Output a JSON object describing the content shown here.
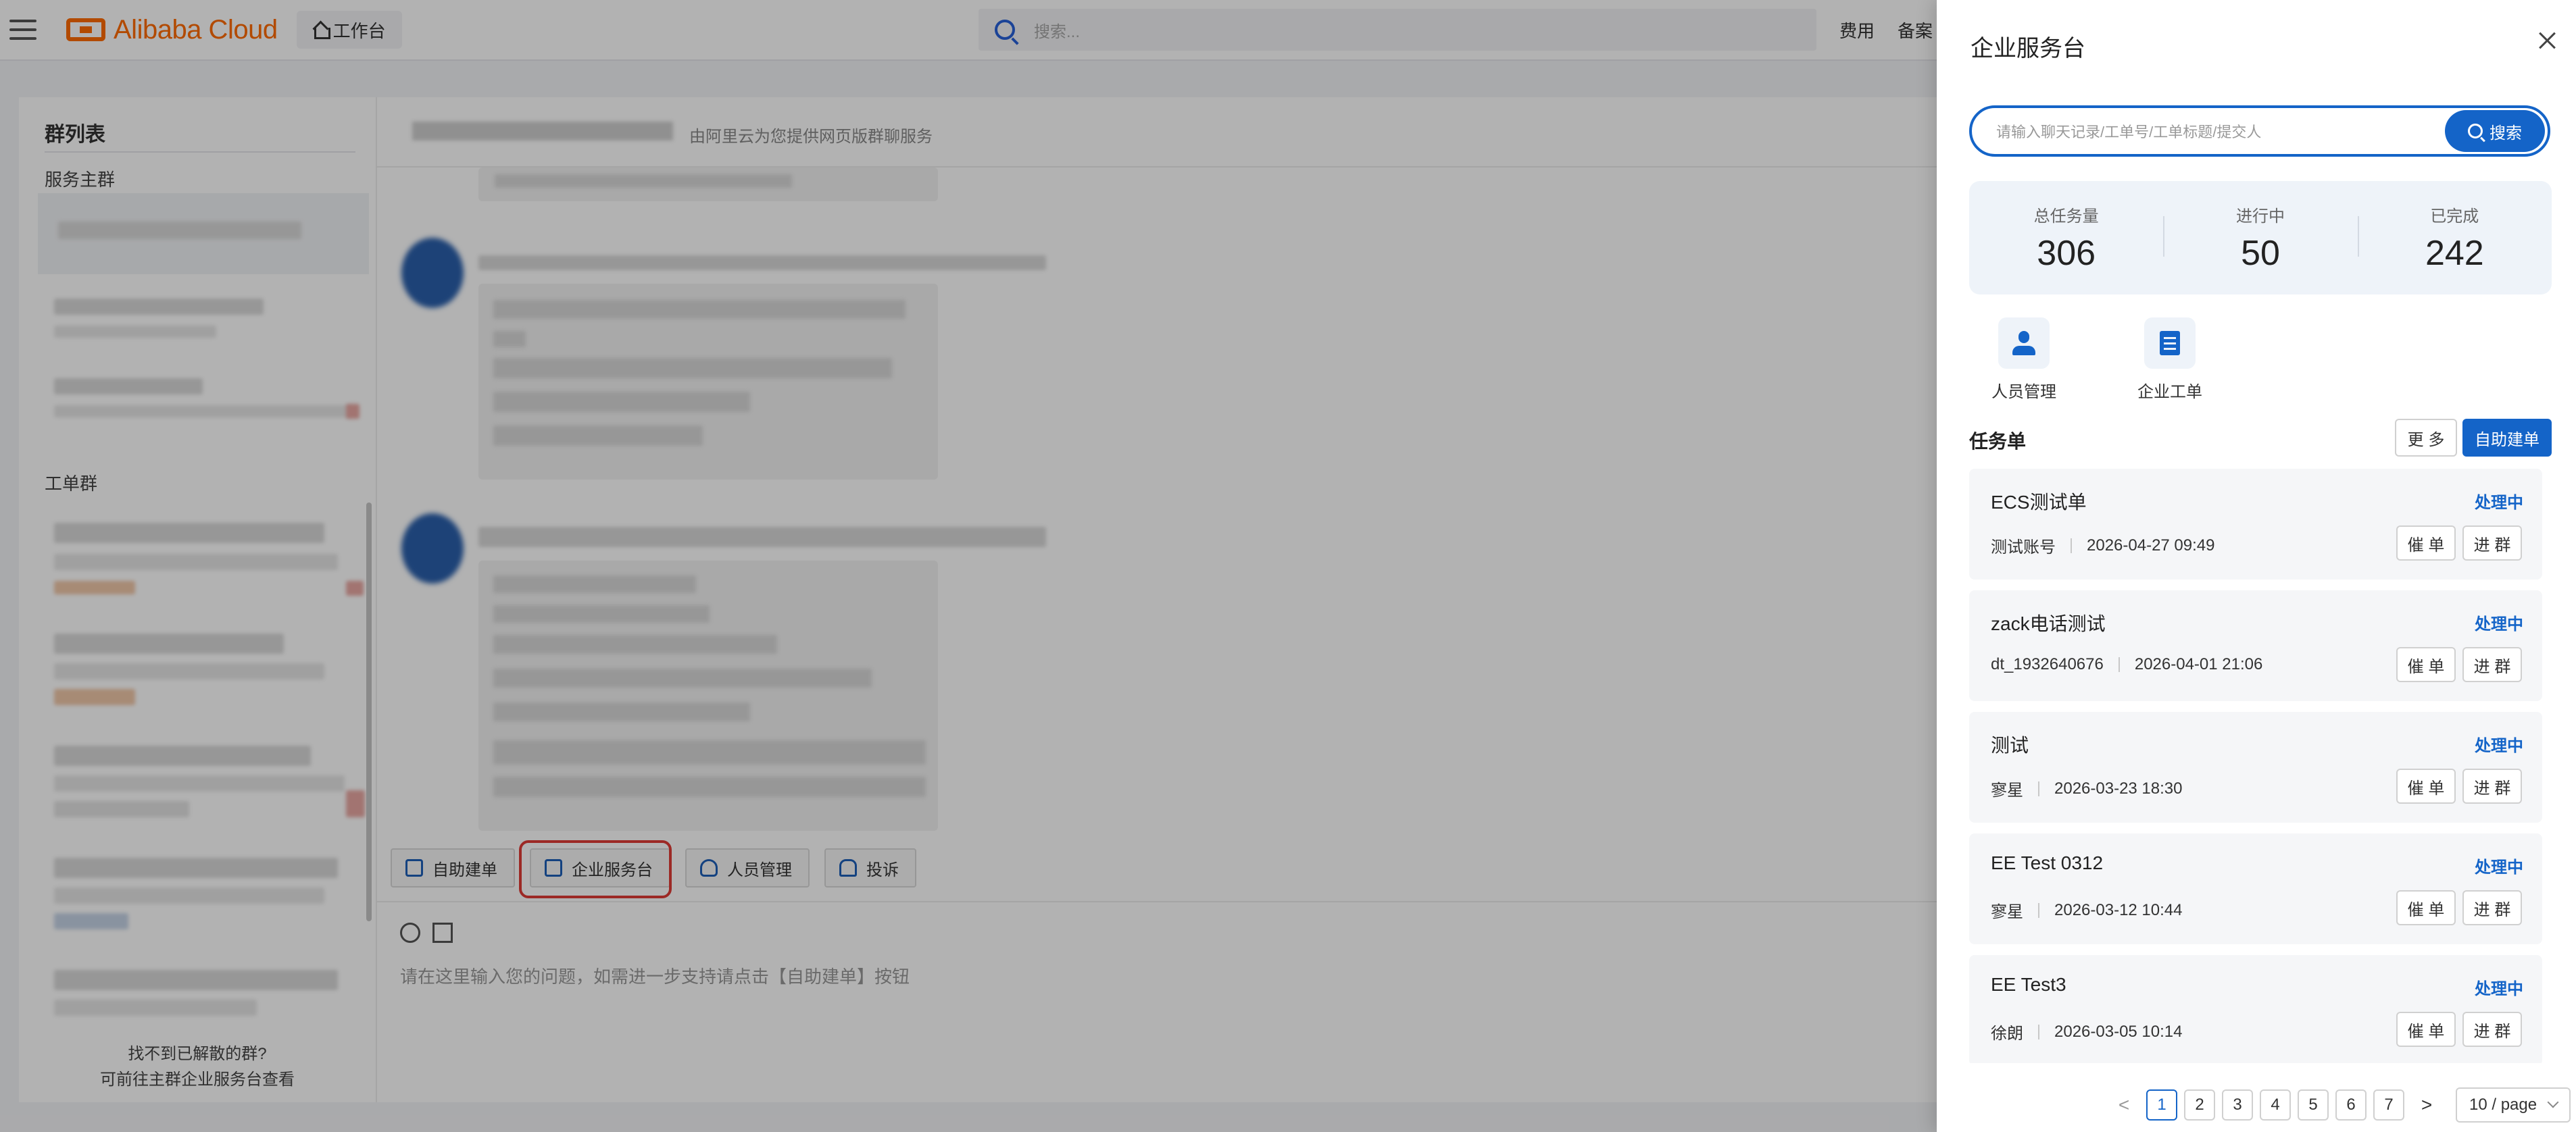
{
  "topbar": {
    "brand": "Alibaba Cloud",
    "workbench": "工作台",
    "search_placeholder": "搜索...",
    "links": [
      "费用",
      "备案"
    ]
  },
  "group_list": {
    "title": "群列表",
    "service_group_label": "服务主群",
    "ticket_group_label": "工单群",
    "footer_line1": "找不到已解散的群?",
    "footer_line2": "可前往主群企业服务台查看"
  },
  "chat": {
    "header_desc": "由阿里云为您提供网页版群聊服务",
    "actions": [
      "自助建单",
      "企业服务台",
      "人员管理",
      "投诉"
    ],
    "input_hint": "请在这里输入您的问题，如需进一步支持请点击【自助建单】按钮"
  },
  "drawer": {
    "title": "企业服务台",
    "search_placeholder": "请输入聊天记录/工单号/工单标题/提交人",
    "search_button": "搜索",
    "stats": [
      {
        "label": "总任务量",
        "value": "306"
      },
      {
        "label": "进行中",
        "value": "50"
      },
      {
        "label": "已完成",
        "value": "242"
      }
    ],
    "quick": [
      {
        "label": "人员管理",
        "icon": "person-icon"
      },
      {
        "label": "企业工单",
        "icon": "document-icon"
      }
    ],
    "task_heading": "任务单",
    "more_button": "更 多",
    "create_button": "自助建单",
    "urge_label": "催 单",
    "join_label": "进 群",
    "tasks": [
      {
        "name": "ECS测试单",
        "status": "处理中",
        "owner": "测试账号",
        "time": "2026-04-27 09:49"
      },
      {
        "name": "zack电话测试",
        "status": "处理中",
        "owner": "dt_1932640676",
        "time": "2026-04-01 21:06"
      },
      {
        "name": "测试",
        "status": "处理中",
        "owner": "寥星",
        "time": "2026-03-23 18:30"
      },
      {
        "name": "EE Test 0312",
        "status": "处理中",
        "owner": "寥星",
        "time": "2026-03-12 10:44"
      },
      {
        "name": "EE Test3",
        "status": "处理中",
        "owner": "徐朗",
        "time": "2026-03-05 10:14"
      }
    ],
    "pagination": {
      "prev": "<",
      "next": ">",
      "pages": [
        "1",
        "2",
        "3",
        "4",
        "5",
        "6",
        "7"
      ],
      "current": "1",
      "page_size": "10 / page"
    }
  },
  "colors": {
    "brand": "#ff6a00",
    "primary": "#1464c8",
    "highlight": "#e03b36"
  }
}
